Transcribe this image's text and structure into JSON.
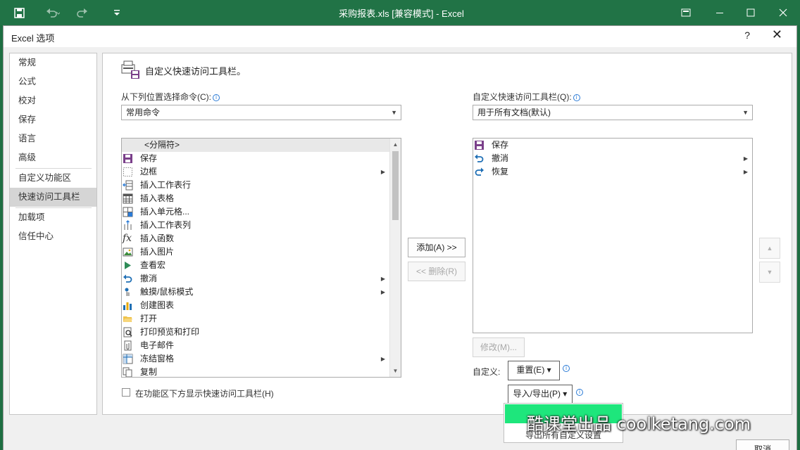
{
  "titlebar": {
    "title": "采购报表.xls  [兼容模式] - Excel"
  },
  "dialog": {
    "title": "Excel 选项",
    "help": "?",
    "close": "✕"
  },
  "nav": {
    "items": [
      "常规",
      "公式",
      "校对",
      "保存",
      "语言",
      "高级",
      "自定义功能区",
      "快速访问工具栏",
      "加载项",
      "信任中心"
    ],
    "active": "快速访问工具栏"
  },
  "panel": {
    "header_title": "自定义快速访问工具栏。",
    "choose_label": "从下列位置选择命令(C):",
    "choose_value": "常用命令",
    "customize_label": "自定义快速访问工具栏(Q):",
    "customize_value": "用于所有文档(默认)",
    "commands": [
      {
        "label": "<分隔符>",
        "icon": "separator-icon"
      },
      {
        "label": "保存",
        "icon": "save-icon"
      },
      {
        "label": "边框",
        "icon": "border-icon"
      },
      {
        "label": "插入工作表行",
        "icon": "insert-rows-icon"
      },
      {
        "label": "插入表格",
        "icon": "insert-table-icon"
      },
      {
        "label": "插入单元格...",
        "icon": "insert-cells-icon"
      },
      {
        "label": "插入工作表列",
        "icon": "insert-columns-icon"
      },
      {
        "label": "插入函数",
        "icon": "function-icon"
      },
      {
        "label": "插入图片",
        "icon": "picture-icon"
      },
      {
        "label": "查看宏",
        "icon": "macro-icon"
      },
      {
        "label": "撤消",
        "icon": "undo-icon"
      },
      {
        "label": "触摸/鼠标模式",
        "icon": "touch-mode-icon"
      },
      {
        "label": "创建图表",
        "icon": "chart-icon"
      },
      {
        "label": "打开",
        "icon": "open-folder-icon"
      },
      {
        "label": "打印预览和打印",
        "icon": "print-preview-icon"
      },
      {
        "label": "电子邮件",
        "icon": "email-icon"
      },
      {
        "label": "冻结窗格",
        "icon": "freeze-panes-icon"
      },
      {
        "label": "复制",
        "icon": "copy-icon"
      }
    ],
    "toolbar_items": [
      {
        "label": "保存",
        "icon": "save-icon"
      },
      {
        "label": "撤消",
        "icon": "undo-icon"
      },
      {
        "label": "恢复",
        "icon": "redo-icon"
      }
    ],
    "add_button": "添加(A) >>",
    "remove_button": "<< 删除(R)",
    "modify_button": "修改(M)...",
    "customize_label2": "自定义:",
    "reset_button": "重置(E) ▾",
    "import_export_button": "导入/导出(P) ▾",
    "show_below_ribbon": "在功能区下方显示快速访问工具栏(H)",
    "popup_item": "导出所有自定义设置"
  },
  "footer": {
    "cancel": "取消"
  },
  "watermark": "酷课堂出品 coolketang.com",
  "colors": {
    "excel_green": "#217346",
    "highlight_green": "#1ee67c"
  }
}
